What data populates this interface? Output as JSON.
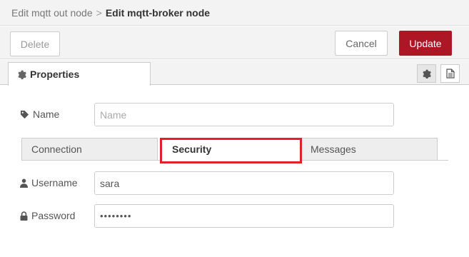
{
  "breadcrumb": {
    "previous": "Edit mqtt out node",
    "separator": ">",
    "current": "Edit mqtt-broker node"
  },
  "toolbar": {
    "delete_label": "Delete",
    "cancel_label": "Cancel",
    "update_label": "Update"
  },
  "tabs": {
    "properties_label": "Properties"
  },
  "form": {
    "name_label": "Name",
    "name_placeholder": "Name",
    "username_label": "Username",
    "username_value": "sara",
    "password_label": "Password",
    "password_value": "••••••••"
  },
  "subtabs": {
    "connection": "Connection",
    "security": "Security",
    "messages": "Messages",
    "selected": "Security"
  },
  "colors": {
    "update_button": "#ad1625",
    "highlight_box": "#e0202c"
  },
  "icons": {
    "properties": "gear-icon",
    "settings_button": "gear-icon",
    "description_button": "document-icon",
    "name": "tag-icon",
    "username": "user-icon",
    "password": "lock-icon"
  }
}
